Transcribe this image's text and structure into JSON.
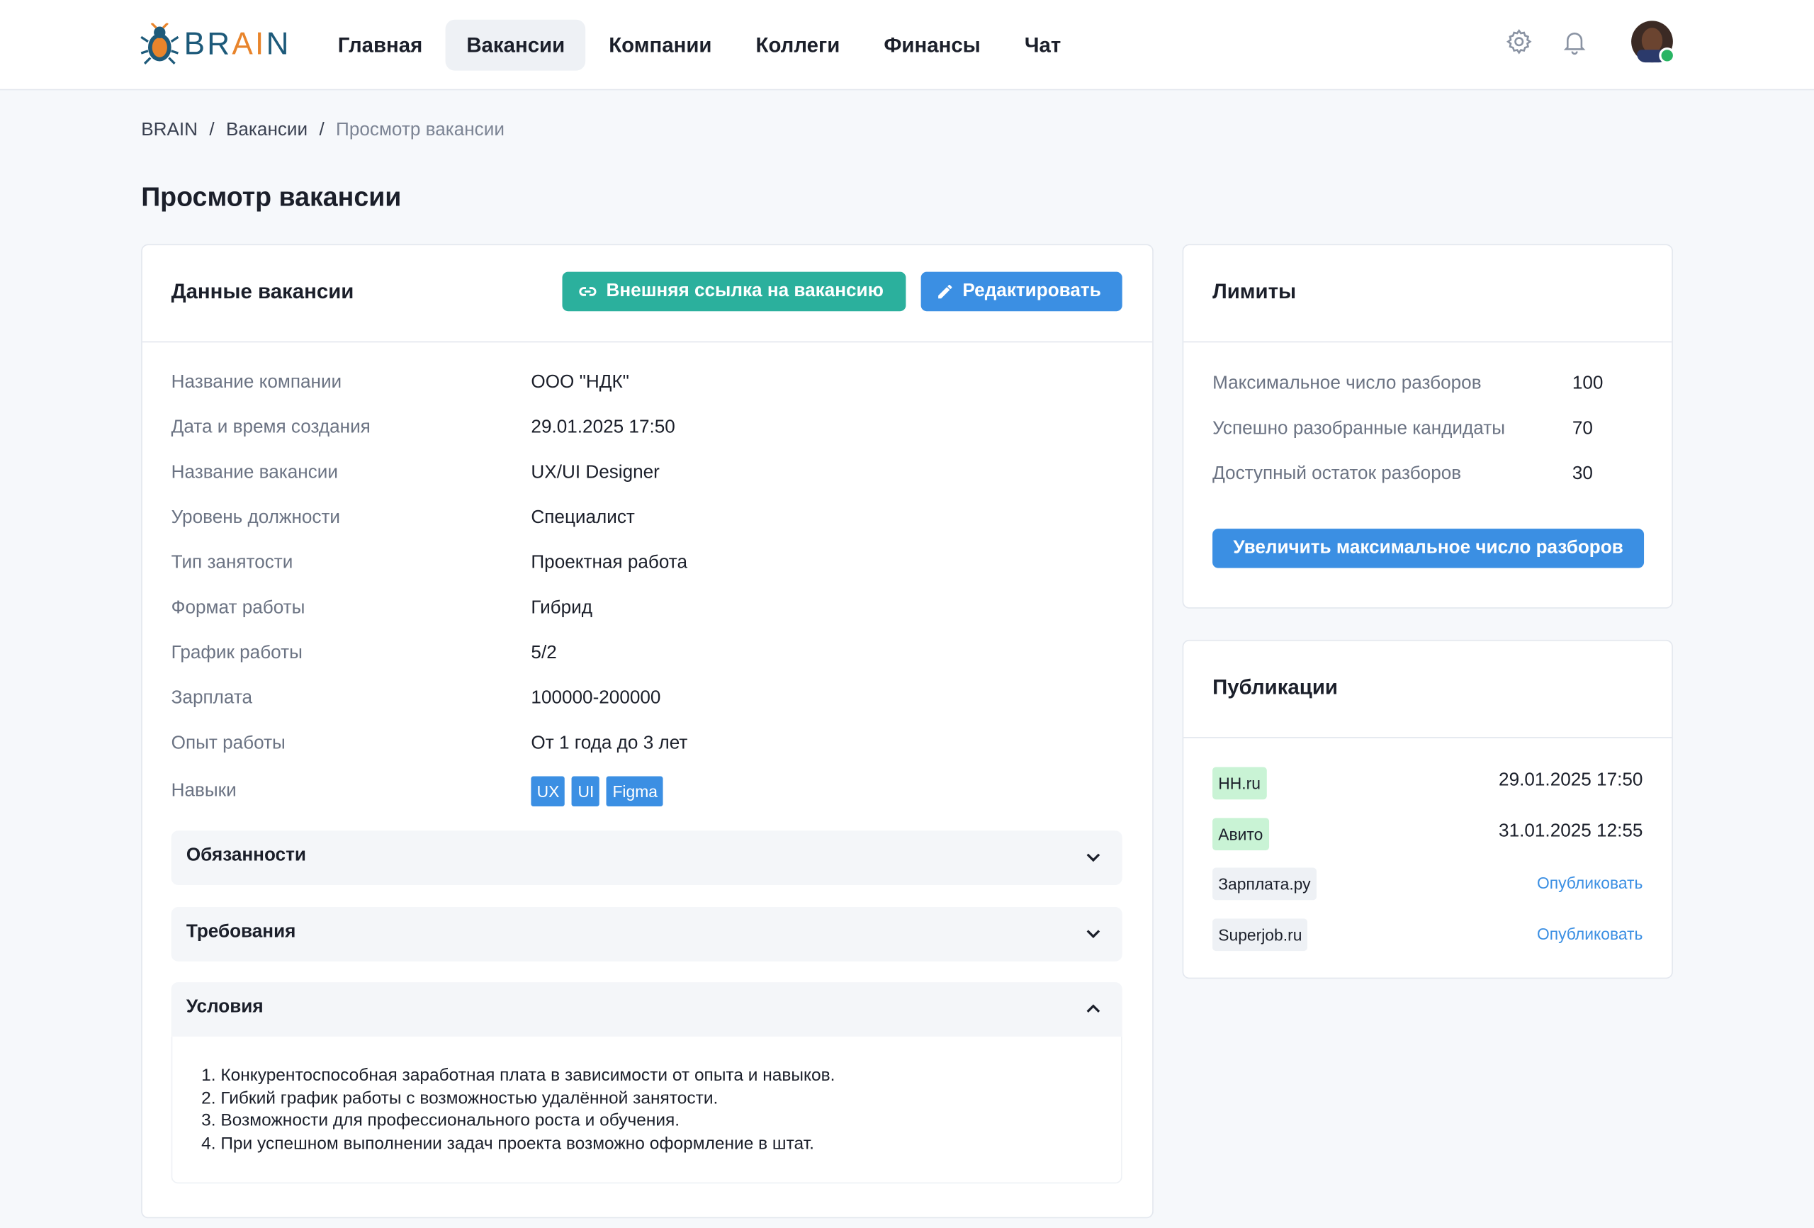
{
  "brand": {
    "logo_text_pre": "BR",
    "logo_text_mid": "AI",
    "logo_text_post": "N"
  },
  "nav": [
    {
      "label": "Главная",
      "active": false
    },
    {
      "label": "Вакансии",
      "active": true
    },
    {
      "label": "Компании",
      "active": false
    },
    {
      "label": "Коллеги",
      "active": false
    },
    {
      "label": "Финансы",
      "active": false
    },
    {
      "label": "Чат",
      "active": false
    }
  ],
  "header_icons": [
    "settings-gear-icon",
    "notification-bell-icon"
  ],
  "breadcrumb": [
    "BRAIN",
    "Вакансии",
    "Просмотр вакансии"
  ],
  "page_title": "Просмотр вакансии",
  "vacancy": {
    "title": "Данные вакансии",
    "link_button": "Внешняя ссылка на вакансию",
    "edit_button": "Редактировать",
    "fields": [
      {
        "label": "Название компании",
        "value": "ООО \"НДК\""
      },
      {
        "label": "Дата и время создания",
        "value": "29.01.2025 17:50"
      },
      {
        "label": "Название вакансии",
        "value": "UX/UI Designer"
      },
      {
        "label": "Уровень должности",
        "value": "Специалист"
      },
      {
        "label": "Тип занятости",
        "value": "Проектная работа"
      },
      {
        "label": "Формат работы",
        "value": "Гибрид"
      },
      {
        "label": "График работы",
        "value": "5/2"
      },
      {
        "label": "Зарплата",
        "value": "100000-200000"
      },
      {
        "label": "Опыт работы",
        "value": "От 1 года до 3 лет"
      }
    ],
    "skills_label": "Навыки",
    "skills": [
      "UX",
      "UI",
      "Figma"
    ],
    "sections": [
      {
        "title": "Обязанности",
        "expanded": false
      },
      {
        "title": "Требования",
        "expanded": false
      },
      {
        "title": "Условия",
        "expanded": true
      }
    ],
    "conditions": [
      "1. Конкурентоспособная заработная плата в зависимости от опыта и навыков.",
      "2. Гибкий график работы с возможностью удалённой занятости.",
      "3. Возможности для профессионального роста и обучения.",
      "4. При успешном выполнении задач проекта возможно оформление в штат."
    ]
  },
  "limits": {
    "title": "Лимиты",
    "rows": [
      {
        "label": "Максимальное число разборов",
        "value": "100"
      },
      {
        "label": "Успешно разобранные кандидаты",
        "value": "70"
      },
      {
        "label": "Доступный остаток разборов",
        "value": "30"
      }
    ],
    "increase_button": "Увеличить максимальное число разборов"
  },
  "publications": {
    "title": "Публикации",
    "items": [
      {
        "site": "HH.ru",
        "status": "published",
        "date": "29.01.2025 17:50"
      },
      {
        "site": "Авито",
        "status": "published",
        "date": "31.01.2025 12:55"
      },
      {
        "site": "Зарплата.ру",
        "status": "not_published",
        "action": "Опубликовать"
      },
      {
        "site": "Superjob.ru",
        "status": "not_published",
        "action": "Опубликовать"
      }
    ]
  },
  "colors": {
    "accent_blue": "#3b8fe3",
    "accent_teal": "#2bb09d",
    "published_green": "#c9f3d5",
    "brand_dark": "#1d5a7a",
    "brand_orange": "#e8842b"
  }
}
